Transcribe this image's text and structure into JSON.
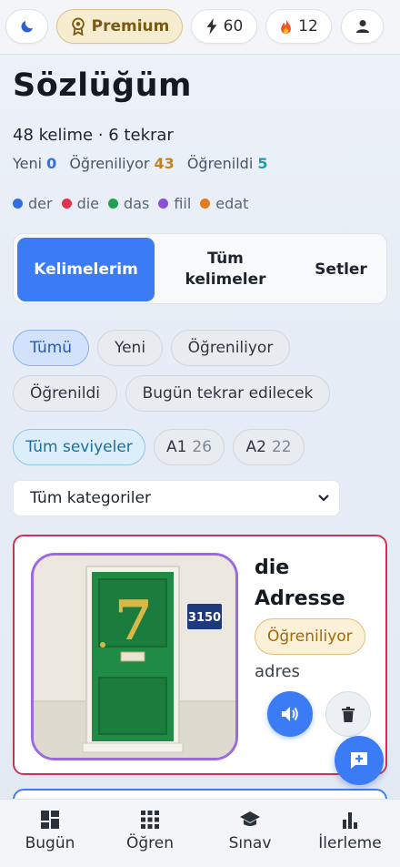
{
  "topbar": {
    "theme_icon": "moon-icon",
    "premium_label": "Premium",
    "premium_icon": "medal-icon",
    "energy_icon": "bolt-icon",
    "energy_count": "60",
    "streak_icon": "flame-icon",
    "streak_count": "12",
    "profile_icon": "user-icon"
  },
  "page": {
    "title": "Sözlüğüm",
    "summary": "48 kelime · 6 tekrar",
    "stats": [
      {
        "label": "Yeni",
        "value": "0",
        "color": "#3b6fd8"
      },
      {
        "label": "Öğreniliyor",
        "value": "43",
        "color": "#c0841a"
      },
      {
        "label": "Öğrenildi",
        "value": "5",
        "color": "#1f9bb0"
      }
    ],
    "legend": [
      {
        "label": "der",
        "color": "#2f6de0"
      },
      {
        "label": "die",
        "color": "#e0334f"
      },
      {
        "label": "das",
        "color": "#22a04e"
      },
      {
        "label": "fiil",
        "color": "#8a4fd8"
      },
      {
        "label": "edat",
        "color": "#e07b1f"
      }
    ]
  },
  "tabs": [
    "Kelimelerim",
    "Tüm kelimeler",
    "Setler"
  ],
  "status_filters": [
    "Tümü",
    "Yeni",
    "Öğreniliyor",
    "Öğrenildi",
    "Bugün tekrar edilecek"
  ],
  "level_filters": [
    {
      "label": "Tüm seviyeler",
      "count": ""
    },
    {
      "label": "A1",
      "count": "26"
    },
    {
      "label": "A2",
      "count": "22"
    }
  ],
  "category_select": {
    "selected": "Tüm kategoriler",
    "icon": "chevron-down-icon"
  },
  "word_card": {
    "article": "die",
    "word": "Adresse",
    "status": "Öğreniliyor",
    "meaning": "adres",
    "door_number": "7",
    "plate_number": "3150",
    "speak_icon": "speaker-icon",
    "delete_icon": "trash-icon"
  },
  "fab_icon": "add-message-icon",
  "bottom_nav": [
    {
      "label": "Bugün",
      "icon": "dashboard-icon"
    },
    {
      "label": "Öğren",
      "icon": "grid-icon"
    },
    {
      "label": "Sınav",
      "icon": "graduation-cap-icon"
    },
    {
      "label": "İlerleme",
      "icon": "bar-chart-icon"
    }
  ]
}
